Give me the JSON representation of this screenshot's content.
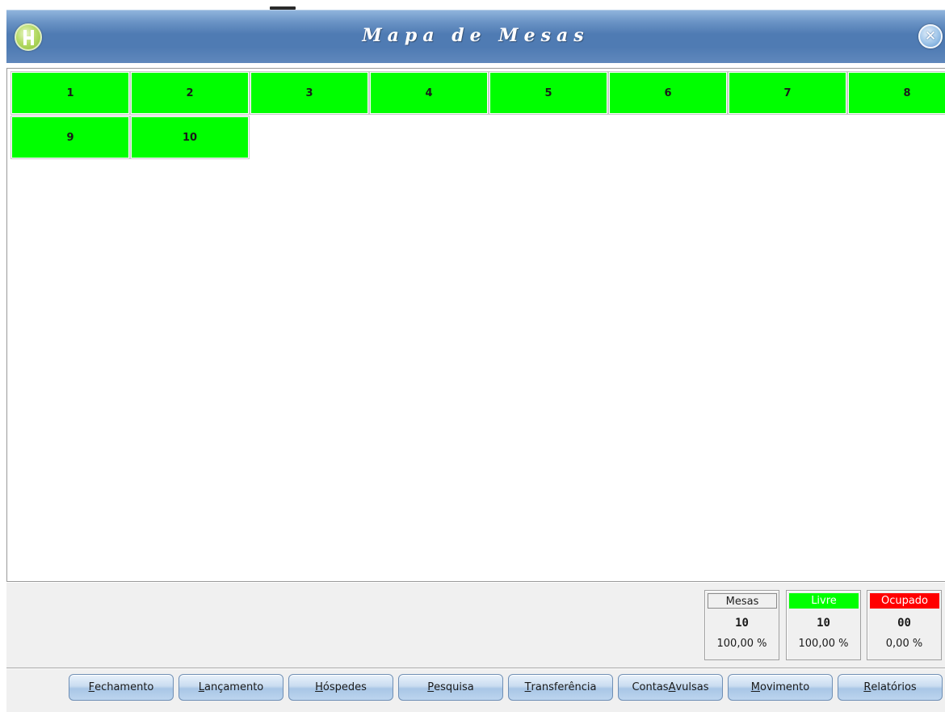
{
  "window": {
    "title": "Mapa de Mesas",
    "logo_icon": "hotel-h-logo",
    "close_icon": "close-circle-icon",
    "close_glyph": "✕"
  },
  "colors": {
    "livre": "#00ff00",
    "ocupado": "#ff0000",
    "titlebar": "#4f7bb3",
    "button": "#c9dcf0"
  },
  "tables": [
    {
      "number": "1",
      "status": "livre"
    },
    {
      "number": "2",
      "status": "livre"
    },
    {
      "number": "3",
      "status": "livre"
    },
    {
      "number": "4",
      "status": "livre"
    },
    {
      "number": "5",
      "status": "livre"
    },
    {
      "number": "6",
      "status": "livre"
    },
    {
      "number": "7",
      "status": "livre"
    },
    {
      "number": "8",
      "status": "livre"
    },
    {
      "number": "9",
      "status": "livre"
    },
    {
      "number": "10",
      "status": "livre"
    }
  ],
  "summary": {
    "mesas": {
      "label": "Mesas",
      "count": "10",
      "percent": "100,00 %"
    },
    "livre": {
      "label": "Livre",
      "count": "10",
      "percent": "100,00 %"
    },
    "ocupado": {
      "label": "Ocupado",
      "count": "00",
      "percent": "0,00 %"
    }
  },
  "buttons": [
    {
      "label": "Fechamento",
      "accel_index": 0
    },
    {
      "label": "Lançamento",
      "accel_index": 0
    },
    {
      "label": "Hóspedes",
      "accel_index": 0
    },
    {
      "label": "Pesquisa",
      "accel_index": 0
    },
    {
      "label": "Transferência",
      "accel_index": 0
    },
    {
      "label": "Contas Avulsas",
      "accel_index": 7
    },
    {
      "label": "Movimento",
      "accel_index": 0
    },
    {
      "label": "Relatórios",
      "accel_index": 0
    }
  ]
}
